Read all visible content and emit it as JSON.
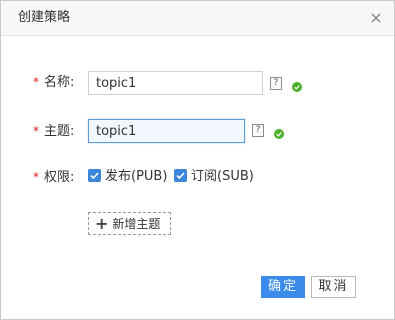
{
  "dialog": {
    "title": "创建策略",
    "close_icon": "close-icon"
  },
  "form": {
    "name": {
      "label": "名称:",
      "value": "topic1",
      "help": "?",
      "status": "valid"
    },
    "topic": {
      "label": "主题:",
      "value": "topic1",
      "help": "?",
      "status": "valid"
    },
    "permission": {
      "label": "权限:",
      "options": [
        {
          "label": "发布(PUB)",
          "checked": true
        },
        {
          "label": "订阅(SUB)",
          "checked": true
        }
      ]
    },
    "add_topic_label": "新增主题",
    "required_mark": "*"
  },
  "footer": {
    "confirm_label": "确定",
    "cancel_label": "取消"
  },
  "colors": {
    "primary": "#3b8beb",
    "valid": "#4caf2a",
    "required": "#e02020",
    "checkbox": "#3b86d8"
  }
}
